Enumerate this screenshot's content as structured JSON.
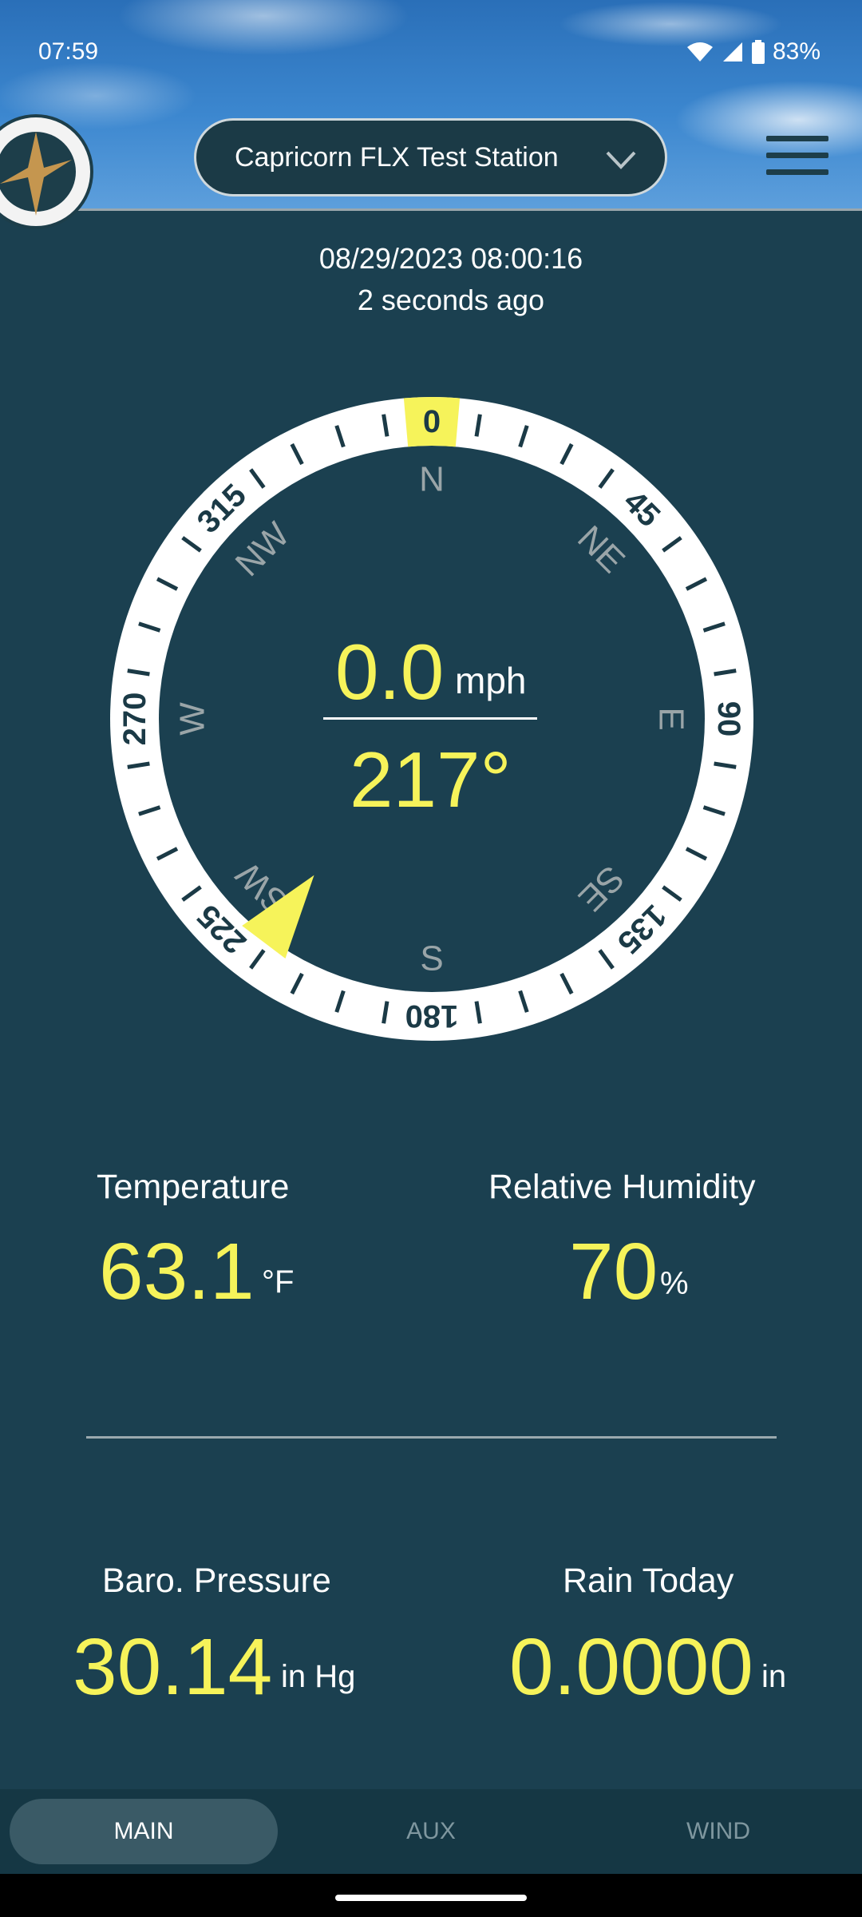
{
  "status_bar": {
    "time": "07:59",
    "battery": "83%"
  },
  "header": {
    "station": "Capricorn FLX Test Station"
  },
  "reading": {
    "timestamp": "08/29/2023 08:00:16",
    "ago": "2 seconds ago"
  },
  "compass": {
    "degree_labels": [
      "0",
      "45",
      "90",
      "135",
      "180",
      "225",
      "270",
      "315"
    ],
    "cardinal_labels": [
      "N",
      "NE",
      "E",
      "SE",
      "S",
      "SW",
      "W",
      "NW"
    ],
    "wind_speed": "0.0",
    "wind_speed_unit": "mph",
    "wind_direction_deg": 217,
    "wind_direction_label": "217°"
  },
  "metrics": {
    "temperature": {
      "label": "Temperature",
      "value": "63.1",
      "unit": "°F"
    },
    "humidity": {
      "label": "Relative Humidity",
      "value": "70",
      "unit": "%"
    },
    "pressure": {
      "label": "Baro. Pressure",
      "value": "30.14",
      "unit": "in Hg"
    },
    "rain": {
      "label": "Rain Today",
      "value": "0.0000",
      "unit": "in"
    }
  },
  "tabs": [
    {
      "label": "MAIN",
      "active": true
    },
    {
      "label": "AUX",
      "active": false
    },
    {
      "label": "WIND",
      "active": false
    }
  ],
  "colors": {
    "background": "#1b4050",
    "accent_yellow": "#f6f35a",
    "tabbar": "#153744"
  },
  "icons": [
    "wifi-icon",
    "signal-icon",
    "battery-icon",
    "compass-logo-icon",
    "chevron-down-icon",
    "menu-icon",
    "wind-direction-arrow-icon"
  ]
}
